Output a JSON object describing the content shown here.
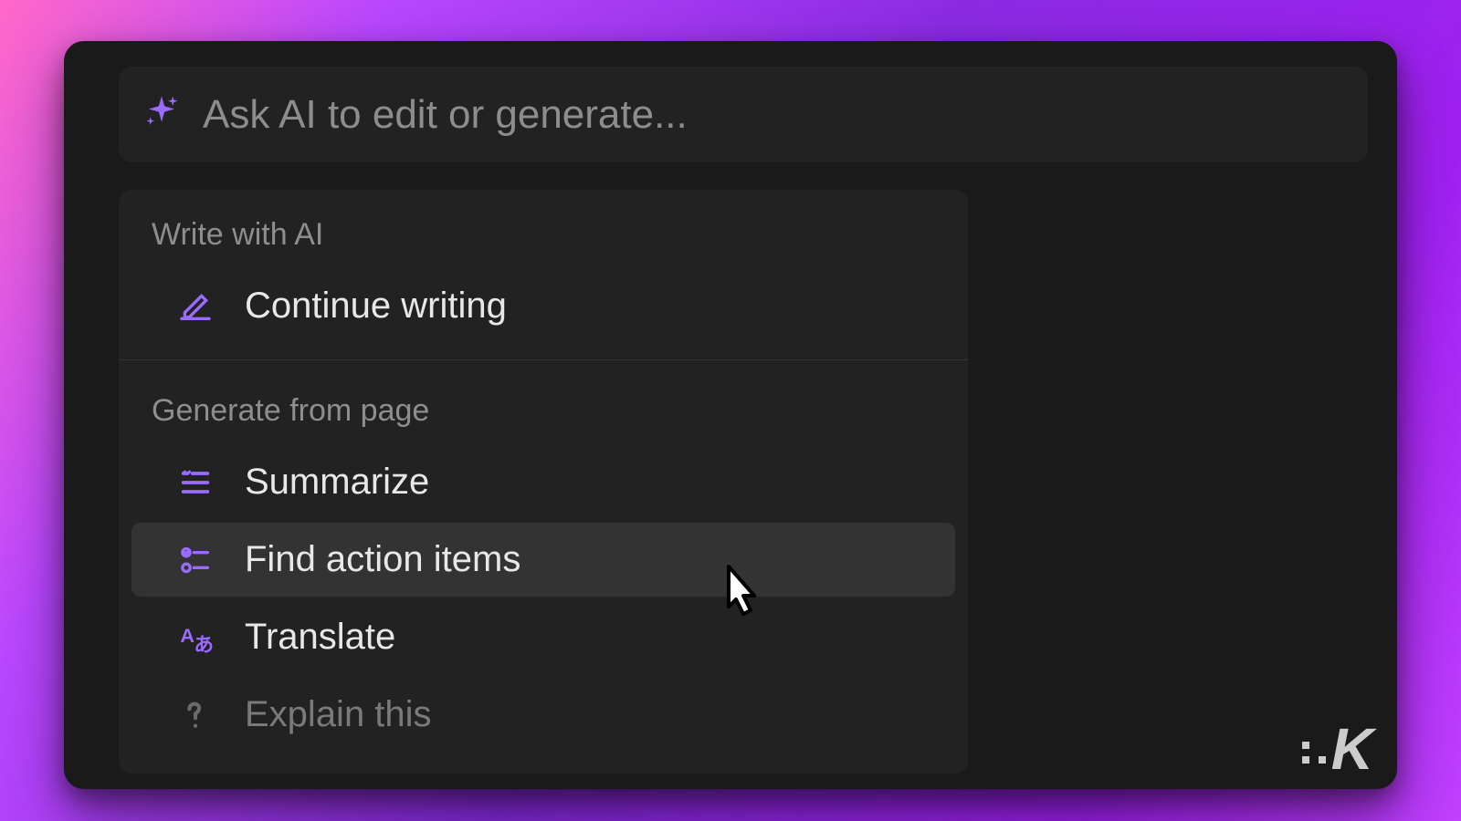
{
  "prompt": {
    "placeholder": "Ask AI to edit or generate..."
  },
  "sections": {
    "write": {
      "label": "Write with AI",
      "items": {
        "continue": "Continue writing"
      }
    },
    "generate": {
      "label": "Generate from page",
      "items": {
        "summarize": "Summarize",
        "find_actions": "Find action items",
        "translate": "Translate",
        "explain": "Explain this"
      }
    }
  },
  "colors": {
    "accent": "#9b6bff"
  },
  "watermark": "K"
}
